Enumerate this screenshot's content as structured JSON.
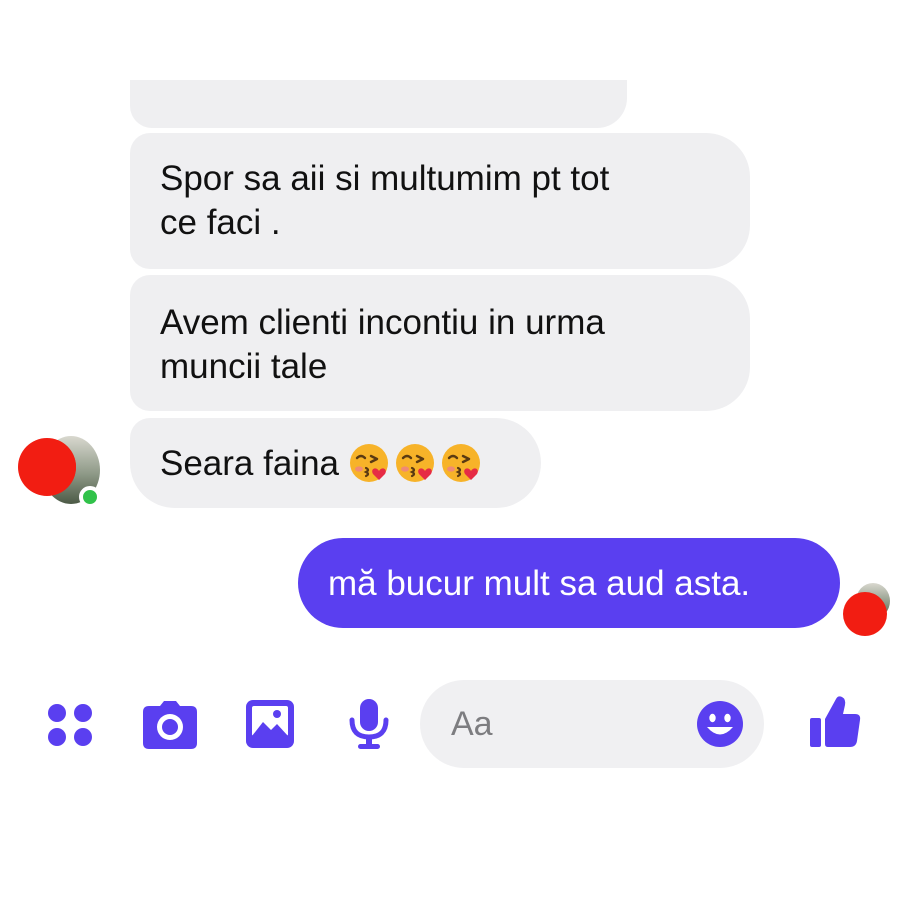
{
  "conversation": {
    "messages_in": [
      {
        "lines": []
      },
      {
        "lines": [
          "Spor sa aii si multumim pt tot",
          "ce faci ."
        ]
      },
      {
        "lines": [
          "Avem clienti incontiu in urma",
          "muncii tale"
        ]
      },
      {
        "lines": [
          "Seara faina"
        ],
        "emoji": [
          "kissing-heart-emoji",
          "kissing-heart-emoji",
          "kissing-heart-emoji"
        ]
      }
    ],
    "message_out": {
      "text": "mă bucur mult sa aud asta."
    }
  },
  "composer": {
    "placeholder": "Aa"
  },
  "toolbar": {
    "icons": [
      "apps-grid-icon",
      "camera-icon",
      "image-icon",
      "microphone-icon",
      "emoji-icon",
      "thumbs-up-icon"
    ]
  },
  "colors": {
    "accent": "#5a3ff0",
    "incoming_bubble": "#efeff1",
    "composer_bg": "#f0f0f2",
    "online": "#31c24a",
    "redaction": "#f21d12"
  }
}
